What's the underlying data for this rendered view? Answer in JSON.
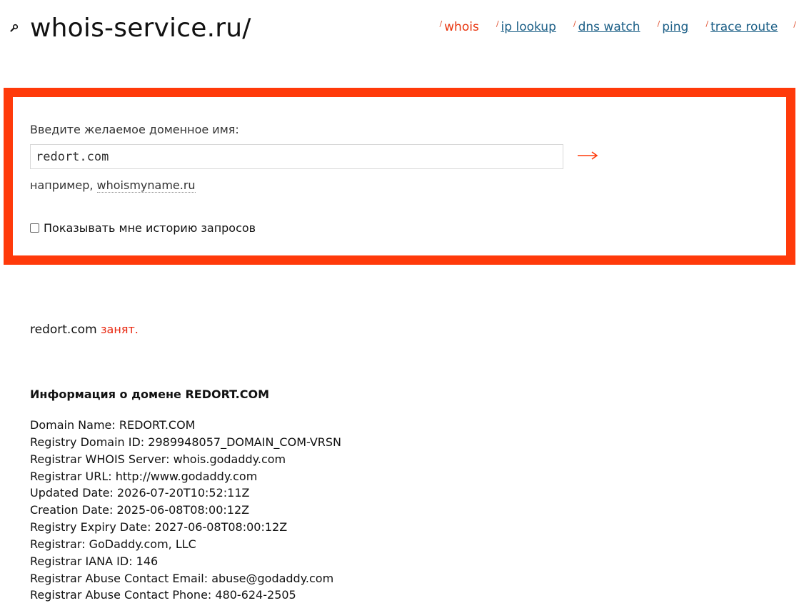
{
  "header": {
    "logo_text": "whois-service.ru/",
    "logo_icon": "search-icon",
    "nav": [
      {
        "label": "whois",
        "active": true
      },
      {
        "label": "ip lookup",
        "active": false
      },
      {
        "label": "dns watch",
        "active": false
      },
      {
        "label": "ping",
        "active": false
      },
      {
        "label": "trace route",
        "active": false
      }
    ]
  },
  "form": {
    "label": "Введите желаемое доменное имя:",
    "input_value": "redort.com",
    "submit_icon": "arrow-right-icon",
    "example_prefix": "например,",
    "example_link": "whoismyname.ru",
    "history_label": "Показывать мне историю запросов",
    "history_checked": false
  },
  "result": {
    "domain": "redort.com",
    "status": "занят.",
    "info_title": "Информация о домене REDORT.COM",
    "lines": [
      "Domain Name: REDORT.COM",
      "Registry Domain ID: 2989948057_DOMAIN_COM-VRSN",
      "Registrar WHOIS Server: whois.godaddy.com",
      "Registrar URL: http://www.godaddy.com",
      "Updated Date: 2026-07-20T10:52:11Z",
      "Creation Date: 2025-06-08T08:00:12Z",
      "Registry Expiry Date: 2027-06-08T08:00:12Z",
      "Registrar: GoDaddy.com, LLC",
      "Registrar IANA ID: 146",
      "Registrar Abuse Contact Email: abuse@godaddy.com",
      "Registrar Abuse Contact Phone: 480-624-2505"
    ]
  },
  "colors": {
    "accent": "#ff3a0a",
    "link": "#1a5e86",
    "status_taken": "#e8240c"
  }
}
